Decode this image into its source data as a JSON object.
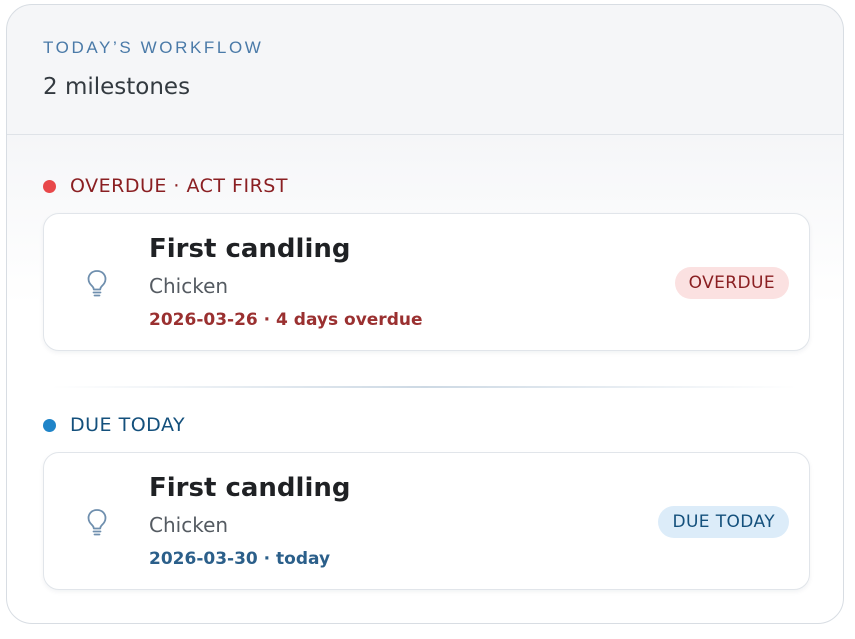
{
  "header": {
    "eyebrow": "TODAY’S WORKFLOW",
    "count": "2 milestones"
  },
  "sections": [
    {
      "label": "OVERDUE · ACT FIRST",
      "status_color": "#e8484a",
      "items": [
        {
          "icon": "lightbulb-icon",
          "title": "First candling",
          "subtitle": "Chicken",
          "meta": "2026-03-26 · 4 days overdue",
          "badge": "OVERDUE"
        }
      ]
    },
    {
      "label": "DUE TODAY",
      "status_color": "#1f84c8",
      "items": [
        {
          "icon": "lightbulb-icon",
          "title": "First candling",
          "subtitle": "Chicken",
          "meta": "2026-03-30 · today",
          "badge": "DUE TODAY"
        }
      ]
    }
  ]
}
